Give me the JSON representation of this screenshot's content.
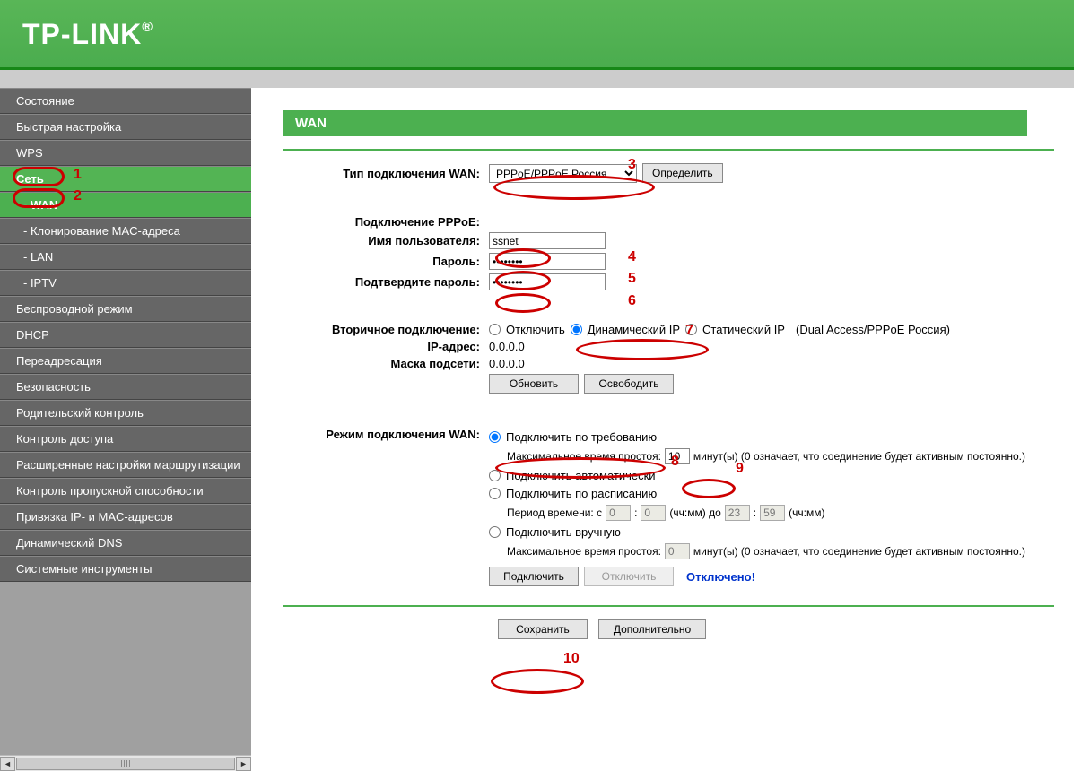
{
  "brand": "TP-LINK",
  "brand_reg": "®",
  "page_title": "WAN",
  "sidebar": {
    "items": [
      {
        "label": "Состояние",
        "active": false
      },
      {
        "label": "Быстрая настройка",
        "active": false
      },
      {
        "label": "WPS",
        "active": false
      },
      {
        "label": "Сеть",
        "active": true
      },
      {
        "label": "- WAN",
        "active": true,
        "sub": true
      },
      {
        "label": "- Клонирование MAC-адреса",
        "active": false,
        "sub": true
      },
      {
        "label": "- LAN",
        "active": false,
        "sub": true
      },
      {
        "label": "- IPTV",
        "active": false,
        "sub": true
      },
      {
        "label": "Беспроводной режим",
        "active": false
      },
      {
        "label": "DHCP",
        "active": false
      },
      {
        "label": "Переадресация",
        "active": false
      },
      {
        "label": "Безопасность",
        "active": false
      },
      {
        "label": "Родительский контроль",
        "active": false
      },
      {
        "label": "Контроль доступа",
        "active": false
      },
      {
        "label": "Расширенные настройки маршрутизации",
        "active": false
      },
      {
        "label": "Контроль пропускной способности",
        "active": false
      },
      {
        "label": "Привязка IP- и MAC-адресов",
        "active": false
      },
      {
        "label": "Динамический DNS",
        "active": false
      },
      {
        "label": "Системные инструменты",
        "active": false
      }
    ]
  },
  "labels": {
    "wan_type": "Тип подключения WAN:",
    "detect": "Определить",
    "pppoe_conn": "Подключение PPPoE:",
    "username": "Имя пользователя:",
    "password": "Пароль:",
    "confirm_password": "Подтвердите пароль:",
    "secondary": "Вторичное подключение:",
    "ip": "IP-адрес:",
    "mask": "Маска подсети:",
    "renew": "Обновить",
    "release": "Освободить",
    "wan_mode": "Режим подключения WAN:",
    "connect": "Подключить",
    "disconnect": "Отключить",
    "status": "Отключено!",
    "save": "Сохранить",
    "advanced": "Дополнительно"
  },
  "fields": {
    "wan_type_value": "PPPoE/PPPoE Россия",
    "username_value": "ssnet",
    "password_value": "********",
    "confirm_value": "********",
    "ip_value": "0.0.0.0",
    "mask_value": "0.0.0.0",
    "idle1": "10",
    "sched_from_h": "0",
    "sched_from_m": "0",
    "sched_to_h": "23",
    "sched_to_m": "59",
    "idle2": "0"
  },
  "radios": {
    "sec_disable": "Отключить",
    "sec_dynip": "Динамический IP",
    "sec_static": "Статический IP",
    "sec_note": "(Dual Access/PPPoE Россия)",
    "mode_demand": "Подключить по требованию",
    "mode_auto": "Подключить автоматически",
    "mode_sched": "Подключить по расписанию",
    "mode_manual": "Подключить вручную"
  },
  "texts": {
    "idle_label": "Максимальное время простоя:",
    "idle_unit": "минут(ы) (0 означает, что соединение будет активным постоянно.)",
    "period": "Период времени:  с",
    "hhmm_to": "(чч:мм) до",
    "hhmm": "(чч:мм)",
    "colon": ":"
  },
  "annotations": {
    "n1": "1",
    "n2": "2",
    "n3": "3",
    "n4": "4",
    "n5": "5",
    "n6": "6",
    "n7": "7",
    "n8": "8",
    "n9": "9",
    "n10": "10"
  }
}
